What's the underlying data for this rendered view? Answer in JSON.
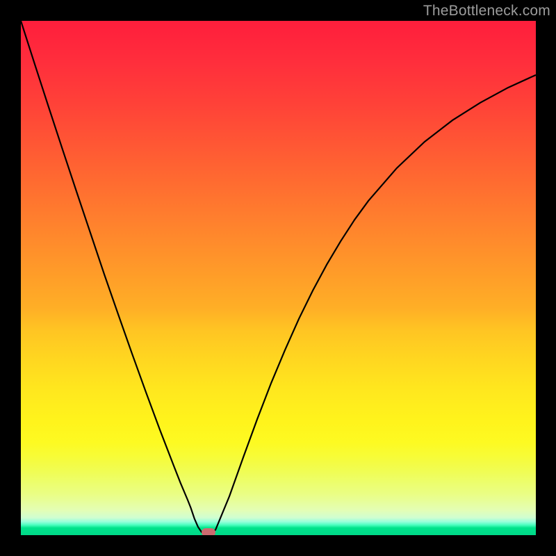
{
  "watermark": "TheBottleneck.com",
  "chart_data": {
    "type": "line",
    "x": [
      0.0,
      0.027,
      0.054,
      0.081,
      0.108,
      0.135,
      0.162,
      0.189,
      0.216,
      0.243,
      0.27,
      0.297,
      0.31,
      0.324,
      0.33,
      0.337,
      0.344,
      0.351,
      0.365,
      0.378,
      0.405,
      0.432,
      0.459,
      0.486,
      0.513,
      0.54,
      0.567,
      0.594,
      0.621,
      0.648,
      0.675,
      0.73,
      0.784,
      0.838,
      0.892,
      0.946,
      1.0
    ],
    "values": [
      1.055,
      0.966,
      0.878,
      0.791,
      0.705,
      0.62,
      0.535,
      0.453,
      0.372,
      0.293,
      0.216,
      0.142,
      0.107,
      0.072,
      0.056,
      0.034,
      0.017,
      0.006,
      0.0,
      0.011,
      0.08,
      0.16,
      0.238,
      0.312,
      0.38,
      0.444,
      0.502,
      0.555,
      0.603,
      0.647,
      0.686,
      0.753,
      0.807,
      0.851,
      0.887,
      0.918,
      0.944
    ],
    "ylim": [
      0,
      1.055
    ],
    "xlim": [
      0,
      1
    ],
    "title": "",
    "xlabel": "",
    "ylabel": "",
    "marker": {
      "x": 0.365,
      "y": 0.0
    },
    "background": "rainbow-vertical-gradient",
    "frame": "#000000"
  },
  "colors": {
    "curve": "#000000",
    "marker": "#cc6b70",
    "frame": "#000000",
    "watermark": "#9c9c9c"
  }
}
